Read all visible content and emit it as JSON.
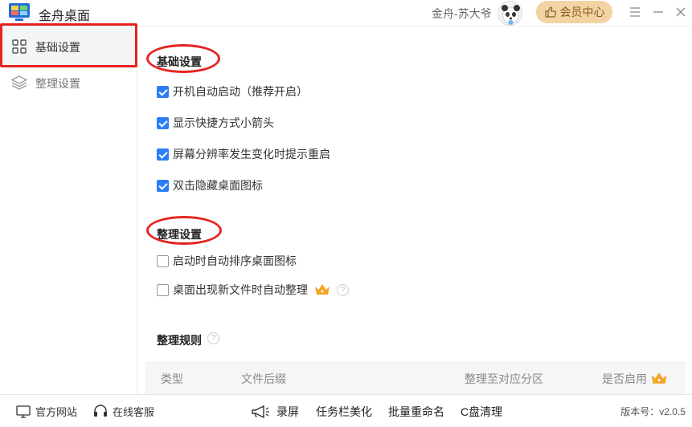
{
  "app": {
    "title": "金舟桌面"
  },
  "header": {
    "user_name": "金舟-苏大爷",
    "vip_label": "会员中心"
  },
  "sidebar": {
    "items": [
      {
        "label": "基础设置",
        "icon": "grid-icon",
        "active": true
      },
      {
        "label": "整理设置",
        "icon": "layers-icon",
        "active": false
      }
    ]
  },
  "basic": {
    "title": "基础设置",
    "options": [
      {
        "label": "开机自动启动（推荐开启）",
        "checked": true
      },
      {
        "label": "显示快捷方式小箭头",
        "checked": true
      },
      {
        "label": "屏幕分辨率发生变化时提示重启",
        "checked": true
      },
      {
        "label": "双击隐藏桌面图标",
        "checked": true
      }
    ]
  },
  "sort": {
    "title": "整理设置",
    "options": [
      {
        "label": "启动时自动排序桌面图标",
        "checked": false
      },
      {
        "label": "桌面出现新文件时自动整理",
        "checked": false
      }
    ]
  },
  "rules": {
    "title": "整理规则",
    "columns": [
      "类型",
      "文件后缀",
      "整理至对应分区",
      "是否启用"
    ]
  },
  "footer": {
    "website": "官方网站",
    "support": "在线客服",
    "tools": [
      "录屏",
      "任务栏美化",
      "批量重命名",
      "C盘清理"
    ],
    "version": "版本号：v2.0.5"
  },
  "colors": {
    "accent": "#2d7df6",
    "highlight": "#e52421",
    "vip": "#f2d4a4"
  }
}
